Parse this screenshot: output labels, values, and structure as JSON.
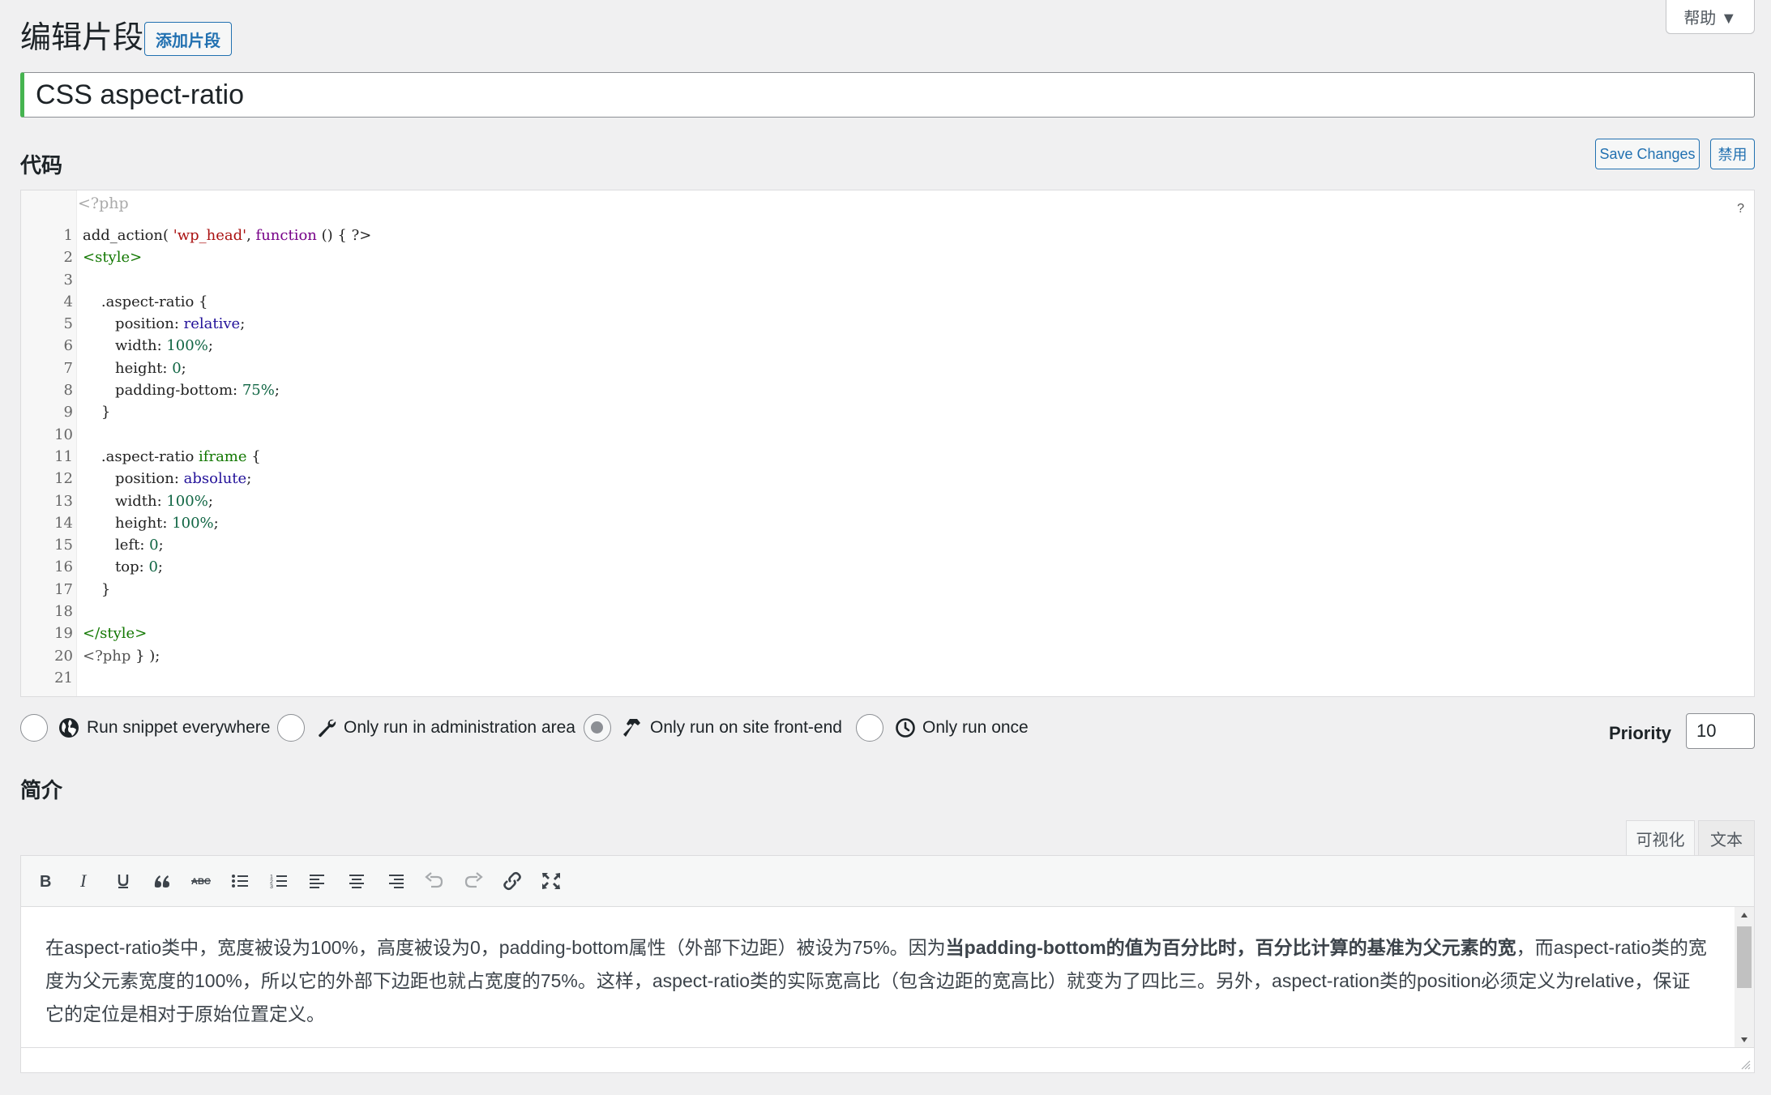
{
  "header": {
    "help_label": "帮助 ▼",
    "page_title": "编辑片段",
    "add_snippet_label": "添加片段",
    "snippet_title": "CSS aspect-ratio"
  },
  "code_section": {
    "heading": "代码",
    "save_label": "Save Changes",
    "disable_label": "禁用",
    "php_open_tag": "<?php",
    "editor_help": "?",
    "lines": [
      "add_action( 'wp_head', function () { ?>",
      "<style>",
      "",
      "    .aspect-ratio {",
      "       position: relative;",
      "       width: 100%;",
      "       height: 0;",
      "       padding-bottom: 75%;",
      "    }",
      "",
      "    .aspect-ratio iframe {",
      "       position: absolute;",
      "       width: 100%;",
      "       height: 100%;",
      "       left: 0;",
      "       top: 0;",
      "    }",
      "",
      "</style>",
      "<?php } );",
      ""
    ]
  },
  "run_options": [
    {
      "label": "Run snippet everywhere",
      "icon": "globe-icon",
      "checked": false
    },
    {
      "label": "Only run in administration area",
      "icon": "wrench-icon",
      "checked": false
    },
    {
      "label": "Only run on site front-end",
      "icon": "hammer-icon",
      "checked": true
    },
    {
      "label": "Only run once",
      "icon": "clock-icon",
      "checked": false
    }
  ],
  "priority": {
    "label": "Priority",
    "value": "10"
  },
  "description_section": {
    "heading": "简介",
    "tab_visual": "可视化",
    "tab_text": "文本",
    "text_part1": "在aspect-ratio类中，宽度被设为100%，高度被设为0，padding-bottom属性（外部下边距）被设为75%。因为",
    "text_bold": "当padding-bottom的值为百分比时，百分比计算的基准为父元素的宽",
    "text_part2": "，而aspect-ratio类的宽度为父元素宽度的100%，所以它的外部下边距也就占宽度的75%。这样，aspect-ratio类的实际宽高比（包含边距的宽高比）就变为了四比三。另外，aspect-ration类的position必须定义为relative，保证它的定位是相对于原始位置定义。"
  },
  "colors": {
    "accent": "#2271b1",
    "title_border": "#46b450",
    "background": "#f0f0f1"
  }
}
